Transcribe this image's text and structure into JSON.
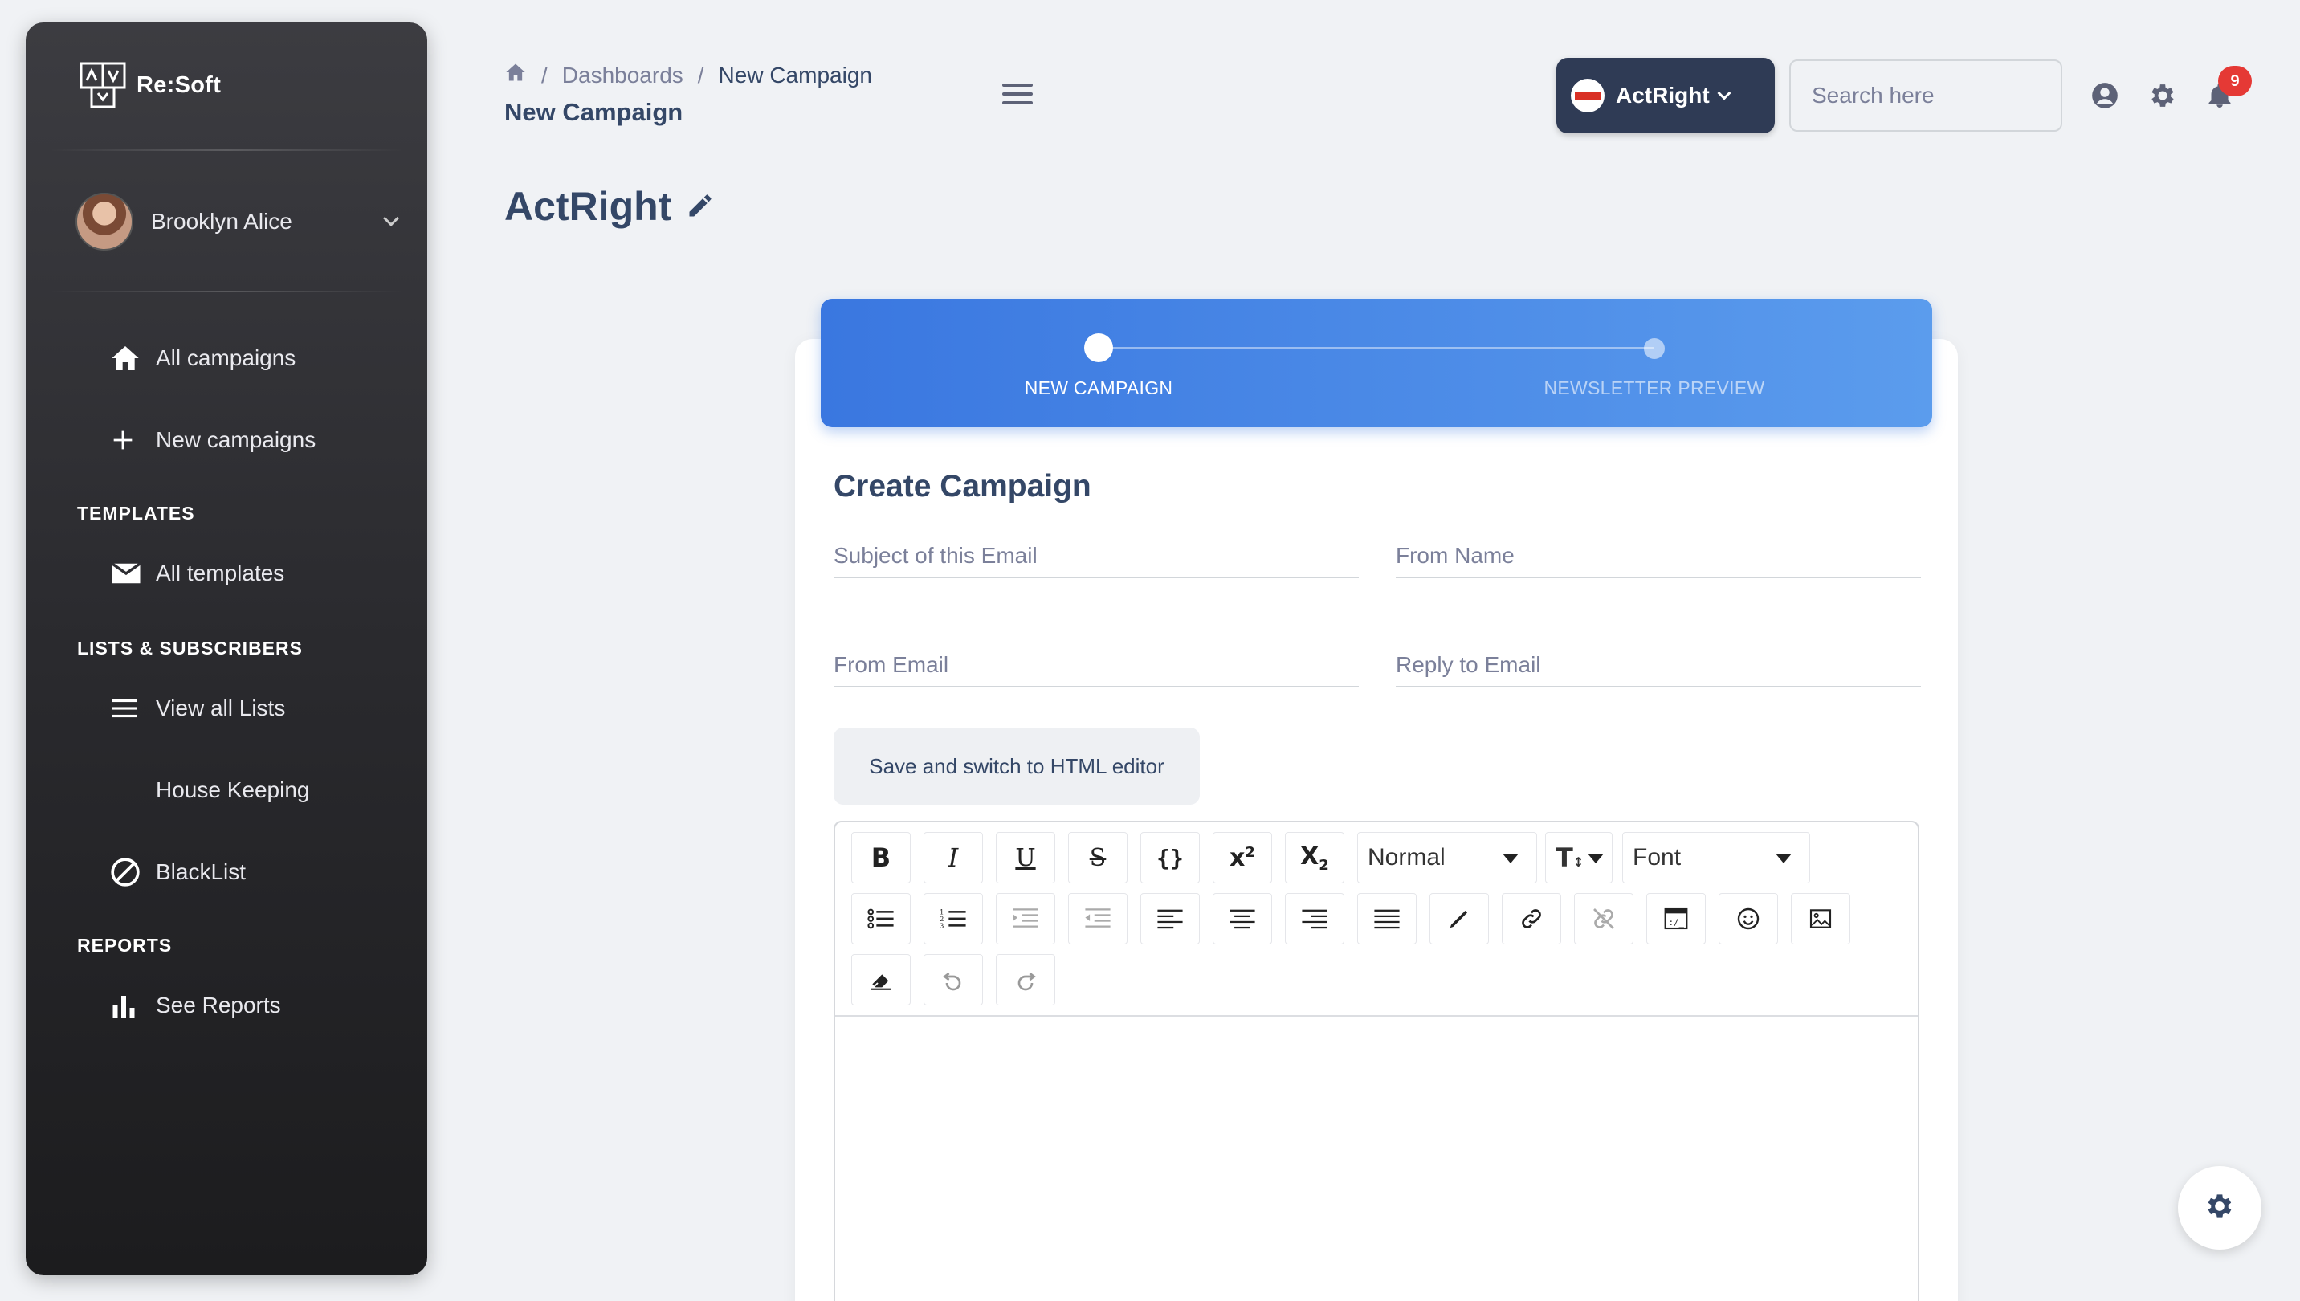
{
  "app": {
    "brand": "Re:Soft"
  },
  "user": {
    "name": "Brooklyn Alice"
  },
  "sidebar": {
    "items": [
      {
        "label": "All campaigns",
        "icon": "home-icon"
      },
      {
        "label": "New campaigns",
        "icon": "plus-icon"
      },
      {
        "label": "All templates",
        "icon": "mail-icon"
      },
      {
        "label": "View all Lists",
        "icon": "list-icon"
      },
      {
        "label": "House Keeping",
        "icon": ""
      },
      {
        "label": "BlackList",
        "icon": "block-icon"
      },
      {
        "label": "See Reports",
        "icon": "bar-chart-icon"
      }
    ],
    "sections": [
      "TEMPLATES",
      "LISTS & SUBSCRIBERS",
      "REPORTS"
    ]
  },
  "header": {
    "breadcrumb": [
      "Dashboards",
      "New Campaign"
    ],
    "subtitle": "New Campaign",
    "account": "ActRight",
    "search_placeholder": "Search here",
    "notifications": "9"
  },
  "page": {
    "title": "ActRight"
  },
  "stepper": {
    "steps": [
      "NEW CAMPAIGN",
      "NEWSLETTER PREVIEW"
    ],
    "active": 0
  },
  "form": {
    "title": "Create Campaign",
    "subject_placeholder": "Subject of this Email",
    "from_name_placeholder": "From Name",
    "from_email_placeholder": "From Email",
    "reply_to_placeholder": "Reply to Email",
    "html_button": "Save and switch to HTML editor"
  },
  "editor": {
    "heading_select": "Normal",
    "font_select": "Font",
    "content": ""
  },
  "colors": {
    "accent": "#3a77e0",
    "account_button": "#2f3b55",
    "badge": "#e53935"
  }
}
